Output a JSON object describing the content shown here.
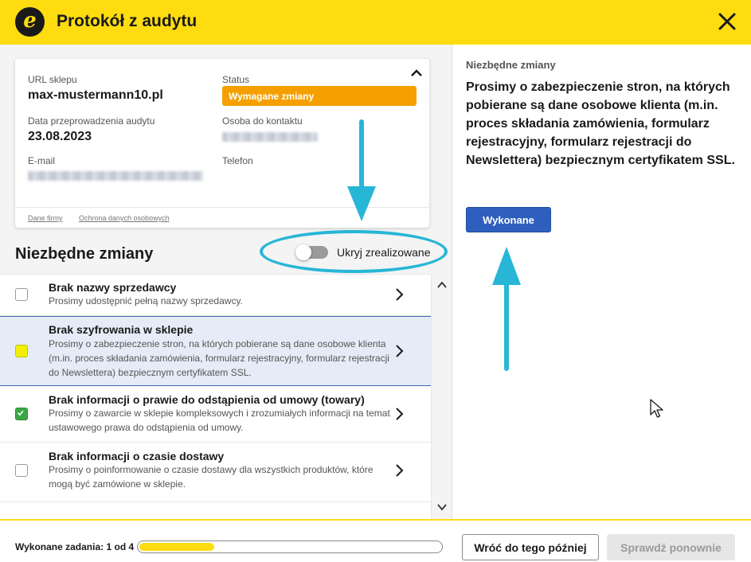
{
  "header": {
    "title": "Protokół z audytu",
    "logo_letter": "e"
  },
  "card": {
    "url_label": "URL sklepu",
    "url_value": "max-mustermann10.pl",
    "status_label": "Status",
    "status_value": "Wymagane zmiany",
    "date_label": "Data przeprowadzenia audytu",
    "date_value": "23.08.2023",
    "contact_label": "Osoba do kontaktu",
    "email_label": "E-mail",
    "phone_label": "Telefon",
    "link_company": "Dane firmy",
    "link_privacy": "Ochrona danych osobowych"
  },
  "section": {
    "title": "Niezbędne zmiany",
    "toggle_label": "Ukryj zrealizowane",
    "toggle_on": false
  },
  "items": [
    {
      "title": "Brak nazwy sprzedawcy",
      "desc": "Prosimy udostępnić pełną nazwy sprzedawcy.",
      "state": "unchecked"
    },
    {
      "title": "Brak szyfrowania w sklepie",
      "desc": "Prosimy o zabezpieczenie stron, na których pobierane są dane osobowe klienta (m.in. proces składania zamówienia, formularz rejestracyjny, formularz rejestracji do Newslettera) bezpiecznym certyfikatem SSL.",
      "state": "highlighted"
    },
    {
      "title": "Brak informacji o prawie do odstąpienia od umowy (towary)",
      "desc": "Prosimy o zawarcie w sklepie kompleksowych i zrozumiałych informacji na temat ustawowego prawa do odstąpienia od umowy.",
      "state": "checked"
    },
    {
      "title": "Brak informacji o czasie dostawy",
      "desc": "Prosimy o poinformowanie o czasie dostawy dla wszystkich produktów, które mogą być zamówione w sklepie.",
      "state": "unchecked"
    }
  ],
  "detail": {
    "label": "Niezbędne zmiany",
    "text": "Prosimy o zabezpieczenie stron, na których pobierane są dane osobowe klienta (m.in. proces składania zamówienia, formularz rejestracyjny, formularz rejestracji do Newslettera) bezpiecznym certyfikatem SSL.",
    "done_button": "Wykonane"
  },
  "footer": {
    "progress_label": "Wykonane zadania: 1 od 4",
    "progress_fraction": 0.25,
    "later_button": "Wróć do tego później",
    "recheck_button": "Sprawdź ponownie"
  },
  "colors": {
    "brand_yellow": "#ffdc0f",
    "status_orange": "#f5a000",
    "primary_blue": "#2f5fbe",
    "annotation_cyan": "#27b6d6",
    "check_green": "#39a845"
  },
  "icons": [
    "close-icon",
    "chevron-up-icon",
    "chevron-right-icon",
    "chevron-down-icon",
    "check-icon",
    "mouse-cursor-icon"
  ]
}
